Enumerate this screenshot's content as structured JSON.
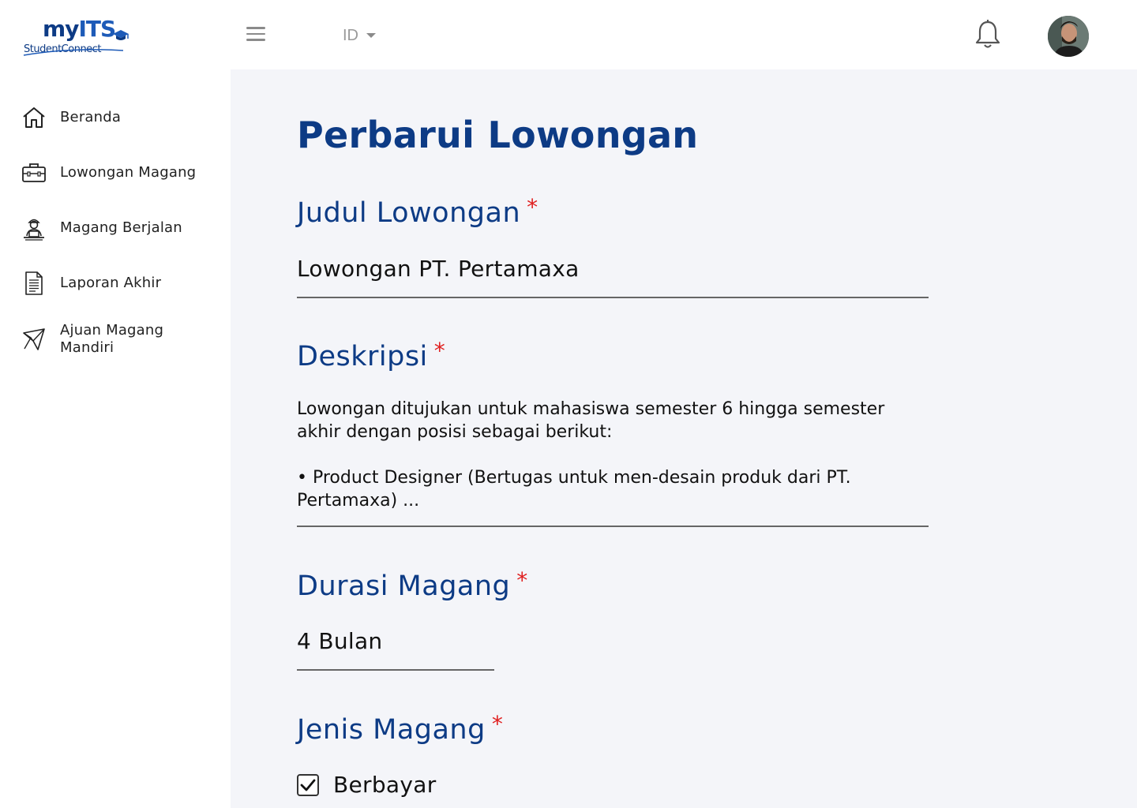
{
  "brand": {
    "name_prefix": "my",
    "name_suffix": "ITS",
    "subtitle": "StudentConnect"
  },
  "header": {
    "language": "ID",
    "menu_icon": "hamburger-icon",
    "notification_icon": "bell-icon"
  },
  "sidebar": {
    "items": [
      {
        "label": "Beranda",
        "icon": "home-icon"
      },
      {
        "label": "Lowongan Magang",
        "icon": "briefcase-icon"
      },
      {
        "label": "Magang Berjalan",
        "icon": "worker-at-laptop-icon"
      },
      {
        "label": "Laporan Akhir",
        "icon": "document-icon"
      },
      {
        "label": "Ajuan Magang Mandiri",
        "icon": "paper-plane-icon"
      }
    ]
  },
  "main": {
    "title": "Perbarui Lowongan",
    "required_marker": "*",
    "fields": {
      "judul": {
        "label": "Judul Lowongan",
        "value": "Lowongan PT. Pertamaxa"
      },
      "deskripsi": {
        "label": "Deskripsi",
        "line1": "Lowongan ditujukan untuk mahasiswa semester 6 hingga semester akhir dengan posisi sebagai berikut:",
        "line2": "• Product Designer (Bertugas untuk men-desain produk dari PT. Pertamaxa) ..."
      },
      "durasi": {
        "label": "Durasi Magang",
        "value": "4 Bulan"
      },
      "jenis": {
        "label": "Jenis Magang",
        "option_label": "Berbayar",
        "checked": true
      }
    }
  },
  "colors": {
    "primary": "#0d3b85",
    "required": "#e02020",
    "main_bg": "#f4f5f9"
  }
}
